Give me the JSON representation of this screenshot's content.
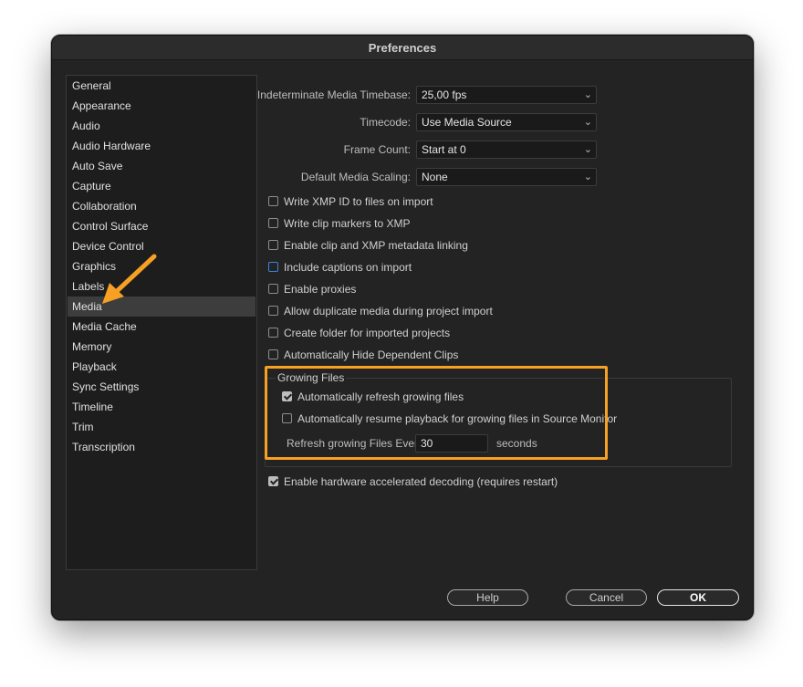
{
  "window": {
    "title": "Preferences"
  },
  "sidebar": {
    "items": [
      {
        "label": "General"
      },
      {
        "label": "Appearance"
      },
      {
        "label": "Audio"
      },
      {
        "label": "Audio Hardware"
      },
      {
        "label": "Auto Save"
      },
      {
        "label": "Capture"
      },
      {
        "label": "Collaboration"
      },
      {
        "label": "Control Surface"
      },
      {
        "label": "Device Control"
      },
      {
        "label": "Graphics"
      },
      {
        "label": "Labels"
      },
      {
        "label": "Media",
        "selected": true
      },
      {
        "label": "Media Cache"
      },
      {
        "label": "Memory"
      },
      {
        "label": "Playback"
      },
      {
        "label": "Sync Settings"
      },
      {
        "label": "Timeline"
      },
      {
        "label": "Trim"
      },
      {
        "label": "Transcription"
      }
    ]
  },
  "media": {
    "timebase": {
      "label": "Indeterminate Media Timebase:",
      "value": "25,00 fps"
    },
    "timecode": {
      "label": "Timecode:",
      "value": "Use Media Source"
    },
    "frame_count": {
      "label": "Frame Count:",
      "value": "Start at 0"
    },
    "scaling": {
      "label": "Default Media Scaling:",
      "value": "None"
    },
    "checkboxes": [
      {
        "label": "Write XMP ID to files on import",
        "checked": false
      },
      {
        "label": "Write clip markers to XMP",
        "checked": false
      },
      {
        "label": "Enable clip and XMP metadata linking",
        "checked": false
      },
      {
        "label": "Include captions on import",
        "checked": false,
        "focused": true
      },
      {
        "label": "Enable proxies",
        "checked": false
      },
      {
        "label": "Allow duplicate media during project import",
        "checked": false
      },
      {
        "label": "Create folder for imported projects",
        "checked": false
      },
      {
        "label": "Automatically Hide Dependent Clips",
        "checked": false
      }
    ],
    "growing_files": {
      "title": "Growing Files",
      "auto_refresh": {
        "label": "Automatically refresh growing files",
        "checked": true
      },
      "auto_resume": {
        "label": "Automatically resume playback for growing files in Source Monitor",
        "checked": false
      },
      "refresh_label": "Refresh growing Files Every",
      "refresh_value": "30",
      "refresh_unit": "seconds"
    },
    "hw_decoding": {
      "label": "Enable hardware accelerated decoding (requires restart)",
      "checked": true
    }
  },
  "buttons": {
    "help": "Help",
    "cancel": "Cancel",
    "ok": "OK"
  },
  "annotation_color": "#f6a024",
  "focus_color": "#3c83e0"
}
